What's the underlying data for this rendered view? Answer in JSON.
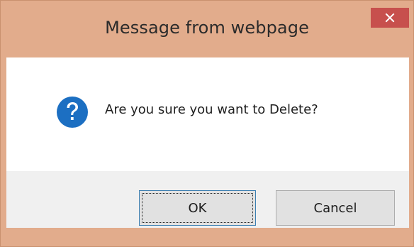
{
  "dialog": {
    "title": "Message from webpage",
    "message": "Are you sure you want to Delete?",
    "icon": "question-icon",
    "close_icon": "close-icon",
    "ok_label": "OK",
    "cancel_label": "Cancel",
    "colors": {
      "frame": "#e2ac8c",
      "close_button": "#c7504d",
      "icon_blue": "#1c6fc2",
      "client": "#ffffff",
      "footer": "#f0f0f0"
    }
  }
}
